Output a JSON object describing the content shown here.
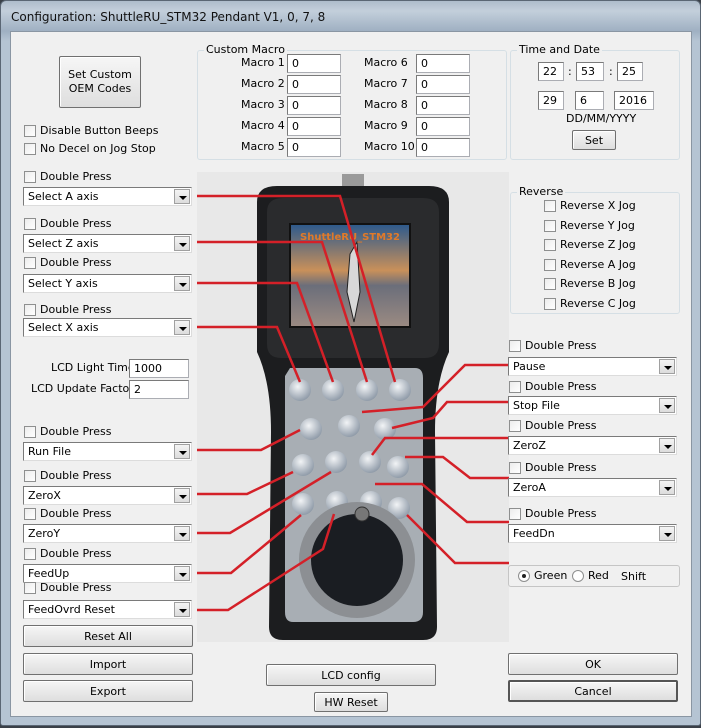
{
  "window": {
    "title": "Configuration: ShuttleRU_STM32 Pendant V1, 0, 7, 8"
  },
  "oem_button": {
    "label_line1": "Set Custom",
    "label_line2": "OEM Codes"
  },
  "options": [
    {
      "label": "Disable Button Beeps",
      "checked": false
    },
    {
      "label": "No Decel on Jog Stop",
      "checked": false
    }
  ],
  "custom_macro": {
    "title": "Custom Macro",
    "macros": [
      {
        "label": "Macro 1",
        "value": "0"
      },
      {
        "label": "Macro 2",
        "value": "0"
      },
      {
        "label": "Macro 3",
        "value": "0"
      },
      {
        "label": "Macro 4",
        "value": "0"
      },
      {
        "label": "Macro 5",
        "value": "0"
      },
      {
        "label": "Macro 6",
        "value": "0"
      },
      {
        "label": "Macro 7",
        "value": "0"
      },
      {
        "label": "Macro 8",
        "value": "0"
      },
      {
        "label": "Macro 9",
        "value": "0"
      },
      {
        "label": "Macro 10",
        "value": "0"
      }
    ]
  },
  "time_date": {
    "title": "Time and Date",
    "hour": "22",
    "minute": "53",
    "second": "25",
    "separator": ":",
    "day": "29",
    "month": "6",
    "year": "2016",
    "format_label": "DD/MM/YYYY",
    "set_label": "Set"
  },
  "reverse": {
    "title": "Reverse",
    "items": [
      {
        "label": "Reverse X Jog",
        "checked": false
      },
      {
        "label": "Reverse Y Jog",
        "checked": false
      },
      {
        "label": "Reverse Z Jog",
        "checked": false
      },
      {
        "label": "Reverse A Jog",
        "checked": false
      },
      {
        "label": "Reverse B Jog",
        "checked": false
      },
      {
        "label": "Reverse C Jog",
        "checked": false
      }
    ]
  },
  "double_press_label": "Double Press",
  "left_buttons": [
    {
      "value": "Select A axis",
      "double_press": false
    },
    {
      "value": "Select Z axis",
      "double_press": false
    },
    {
      "value": "Select Y axis",
      "double_press": false
    },
    {
      "value": "Select X axis",
      "double_press": false
    },
    {
      "value": "Run File",
      "double_press": false
    },
    {
      "value": "ZeroX",
      "double_press": false
    },
    {
      "value": "ZeroY",
      "double_press": false
    },
    {
      "value": "FeedUp",
      "double_press": false
    },
    {
      "value": "FeedOvrd Reset",
      "double_press": false
    }
  ],
  "right_buttons": [
    {
      "value": "Pause",
      "double_press": false
    },
    {
      "value": "Stop File",
      "double_press": false
    },
    {
      "value": "ZeroZ",
      "double_press": false
    },
    {
      "value": "ZeroA",
      "double_press": false
    },
    {
      "value": "FeedDn",
      "double_press": false
    }
  ],
  "lcd": {
    "light_time_label": "LCD Light Time",
    "light_time_value": "1000",
    "update_factor_label": "LCD Update Factor",
    "update_factor_value": "2"
  },
  "pendant_screen_text": "ShuttleRU_STM32",
  "shift": {
    "green_label": "Green",
    "red_label": "Red",
    "shift_label": "Shift",
    "selected": "Green"
  },
  "buttons": {
    "reset_all": "Reset All",
    "import": "Import",
    "export": "Export",
    "lcd_config": "LCD config",
    "hw_reset": "HW Reset",
    "ok": "OK",
    "cancel": "Cancel"
  },
  "colors": {
    "leader_line": "#d42028",
    "lcd_title": "#e07a2a"
  }
}
